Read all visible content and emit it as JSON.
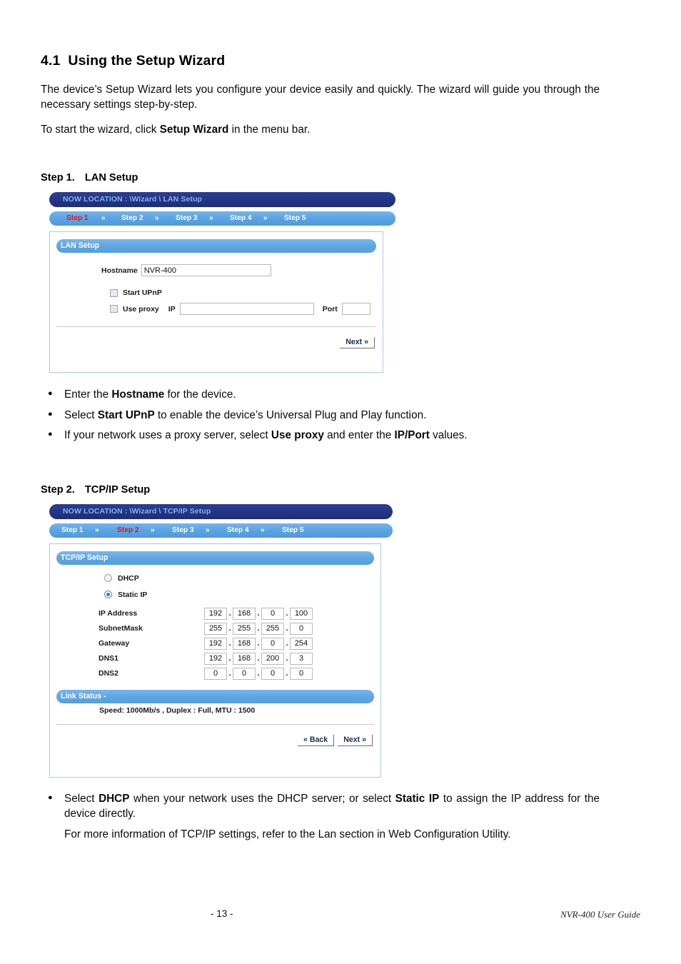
{
  "document": {
    "section": {
      "number": "4.1",
      "title": "Using the Setup Wizard"
    },
    "intro_paragraph_1_a": "The device’s Setup Wizard lets you configure your device easily and quickly. The wizard will guide you through the necessary settings step-by-step.",
    "intro_paragraph_2_a": "To start the wizard, click ",
    "intro_paragraph_2_b": "Setup Wizard",
    "intro_paragraph_2_c": " in the menu bar."
  },
  "step1": {
    "heading_label": "Step 1.",
    "heading_title": "LAN Setup",
    "location_bar": "NOW LOCATION : \\Wizard \\ LAN Setup",
    "steps": [
      {
        "label": "Step 1",
        "active": true
      },
      {
        "label": "Step 2",
        "active": false
      },
      {
        "label": "Step 3",
        "active": false
      },
      {
        "label": "Step 4",
        "active": false
      },
      {
        "label": "Step 5",
        "active": false
      }
    ],
    "separator": "»",
    "panel_title": "LAN Setup",
    "hostname_label": "Hostname",
    "hostname_value": "NVR-400",
    "start_upnp_label": "Start UPnP",
    "start_upnp_checked": false,
    "use_proxy_label": "Use proxy",
    "use_proxy_checked": false,
    "proxy_ip_label": "IP",
    "proxy_ip_value": "",
    "proxy_port_label": "Port",
    "proxy_port_value": "",
    "next_button": "Next »",
    "bullets": [
      {
        "pre": "Enter the ",
        "bold": "Hostname",
        "post": " for the device."
      },
      {
        "pre": "Select ",
        "bold": "Start UPnP",
        "post": " to enable the device’s Universal Plug and Play function."
      },
      {
        "pre": "If your network uses a proxy server, select ",
        "bold": "Use proxy",
        "post": " and enter the ",
        "bold2": "IP/Port",
        "post2": " values."
      }
    ]
  },
  "step2": {
    "heading_label": "Step 2.",
    "heading_title": "TCP/IP Setup",
    "location_bar": "NOW LOCATION : \\Wizard \\ TCP/IP Setup",
    "steps": [
      {
        "label": "Step 1",
        "active": false
      },
      {
        "label": "Step 2",
        "active": true
      },
      {
        "label": "Step 3",
        "active": false
      },
      {
        "label": "Step 4",
        "active": false
      },
      {
        "label": "Step 5",
        "active": false
      }
    ],
    "separator": "»",
    "panel_title": "TCP/IP Setup",
    "dhcp_label": "DHCP",
    "dhcp_selected": false,
    "static_ip_label": "Static IP",
    "static_ip_selected": true,
    "fields": [
      {
        "label": "IP Address",
        "octets": [
          "192",
          "168",
          "0",
          "100"
        ]
      },
      {
        "label": "SubnetMask",
        "octets": [
          "255",
          "255",
          "255",
          "0"
        ]
      },
      {
        "label": "Gateway",
        "octets": [
          "192",
          "168",
          "0",
          "254"
        ]
      },
      {
        "label": "DNS1",
        "octets": [
          "192",
          "168",
          "200",
          "3"
        ]
      },
      {
        "label": "DNS2",
        "octets": [
          "0",
          "0",
          "0",
          "0"
        ]
      }
    ],
    "link_status_title": "Link Status -",
    "link_status_text": "Speed: 1000Mb/s , Duplex : Full, MTU : 1500",
    "back_button": "« Back",
    "next_button": "Next »",
    "bullets": [
      {
        "pre": "Select ",
        "bold": "DHCP",
        "post": " when your network uses the DHCP server; or select ",
        "bold2": "Static IP",
        "post2": " to assign the IP address for the device directly."
      }
    ],
    "note": "For more information of TCP/IP settings, refer to the Lan section in Web Configuration Utility."
  },
  "footer": {
    "page_number": "- 13 -",
    "guide_title": "NVR-400 User Guide"
  },
  "colors": {
    "location_bar_bg": "#26368a",
    "location_bar_text": "#7fb3e8",
    "step_bar_bg": "#5ba3e2",
    "panel_head_bg": "#5ea5e1",
    "active_step_text": "#e8141b",
    "panel_border": "#a9c9e8"
  }
}
